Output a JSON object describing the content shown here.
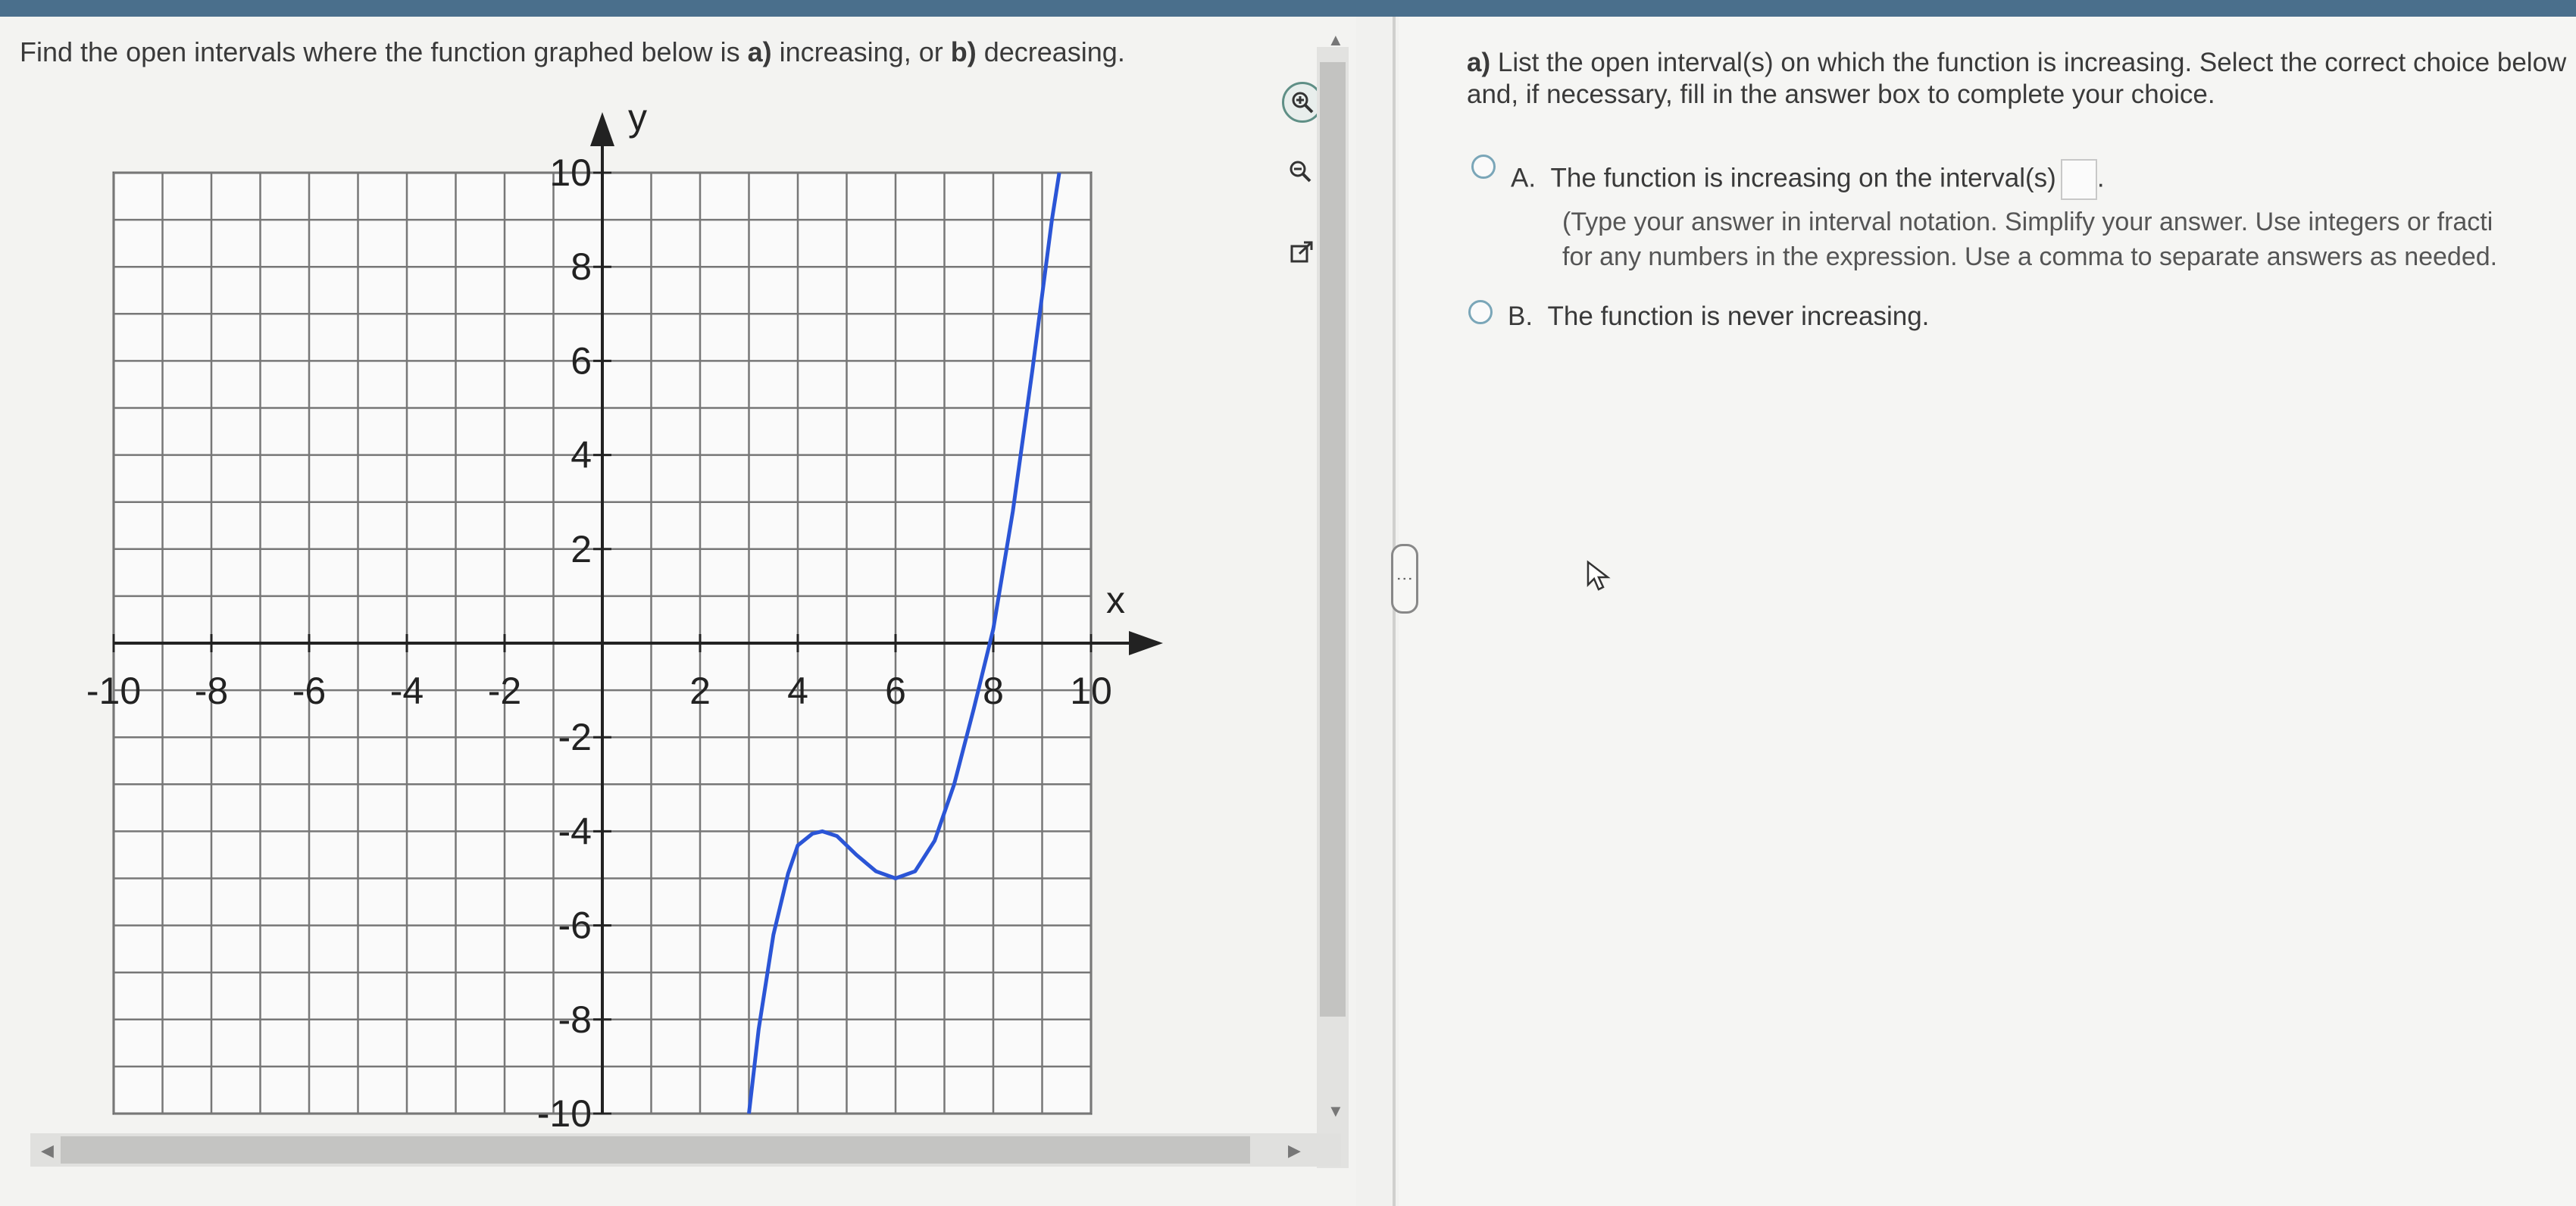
{
  "question": {
    "pre": "Find the open intervals where the function graphed below is ",
    "a_letter": "a)",
    "mid": " increasing, or ",
    "b_letter": "b)",
    "post": " decreasing."
  },
  "graph": {
    "x_label": "x",
    "y_label": "y",
    "x_ticks": [
      "-10",
      "-8",
      "-6",
      "-4",
      "-2",
      "2",
      "4",
      "6",
      "8",
      "10"
    ],
    "y_ticks": [
      "10",
      "8",
      "6",
      "4",
      "2",
      "-2",
      "-4",
      "-6",
      "-8",
      "-10"
    ],
    "curve_color": "#2b55d6",
    "curve_points": [
      [
        3,
        -10
      ],
      [
        3.2,
        -8.2
      ],
      [
        3.5,
        -6.2
      ],
      [
        3.8,
        -4.9
      ],
      [
        4,
        -4.3
      ],
      [
        4.3,
        -4.05
      ],
      [
        4.5,
        -4
      ],
      [
        4.8,
        -4.1
      ],
      [
        5.2,
        -4.5
      ],
      [
        5.6,
        -4.85
      ],
      [
        6,
        -5
      ],
      [
        6.4,
        -4.85
      ],
      [
        6.8,
        -4.2
      ],
      [
        7.2,
        -3
      ],
      [
        7.6,
        -1.4
      ],
      [
        8,
        0.3
      ],
      [
        8.4,
        2.8
      ],
      [
        8.8,
        5.8
      ],
      [
        9.2,
        9
      ],
      [
        9.35,
        10
      ]
    ]
  },
  "tools": {
    "zoom_in": "zoom-in-icon",
    "zoom_out": "zoom-out-icon",
    "popout": "external-link-icon"
  },
  "part_a": {
    "letter": "a)",
    "text": " List the open interval(s) on which the function is increasing. Select the correct choice below and, if necessary, fill in the answer box to complete your choice."
  },
  "choices": [
    {
      "letter": "A.",
      "text": "The function is increasing on the interval(s)"
    },
    {
      "letter": "B.",
      "text": "The function is never increasing."
    }
  ],
  "note_line1": "(Type your answer in interval notation. Simplify your answer. Use integers or fracti",
  "note_line2": "for any numbers in the expression. Use a comma to separate answers as needed."
}
